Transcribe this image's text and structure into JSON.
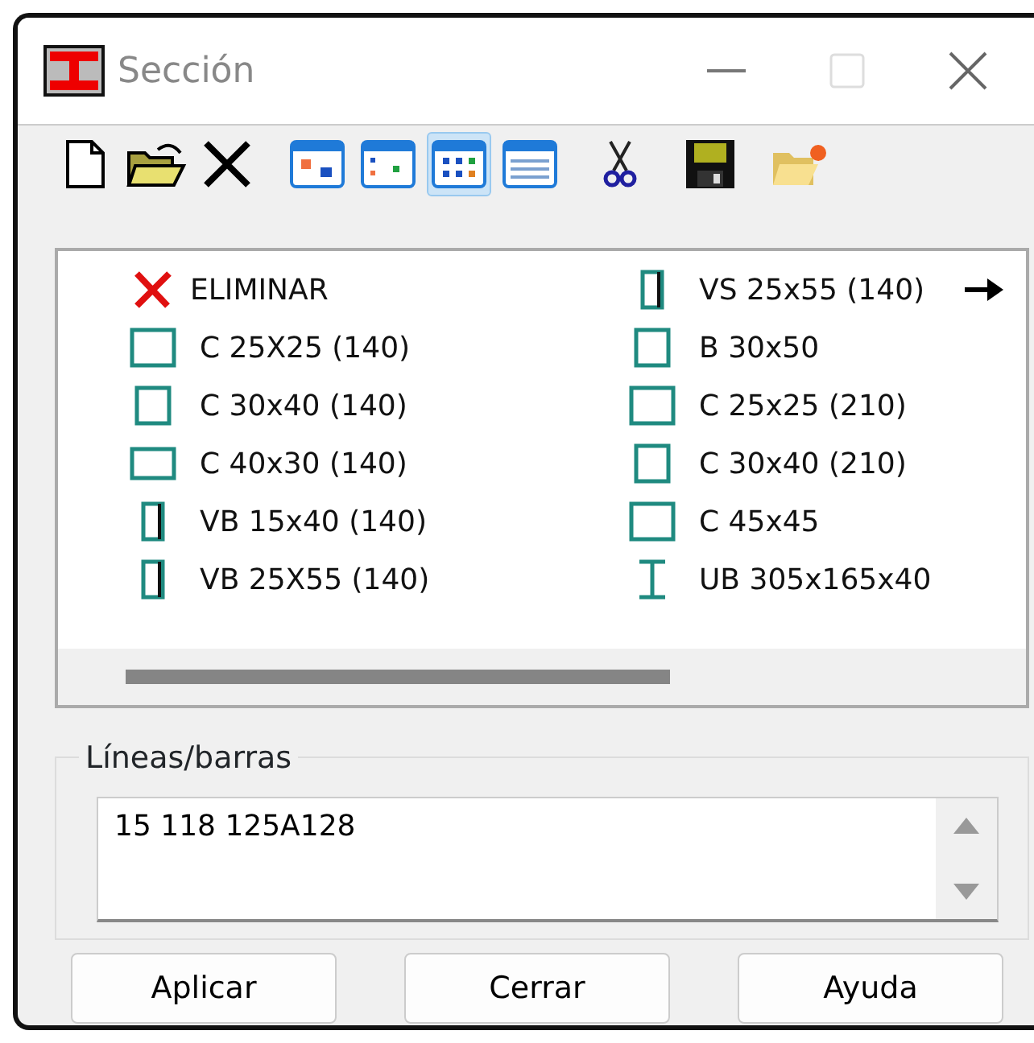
{
  "window": {
    "title": "Sección",
    "maximize_disabled": true
  },
  "toolbar": [
    {
      "kind": "new",
      "selected": false
    },
    {
      "kind": "open",
      "selected": false
    },
    {
      "kind": "delete",
      "selected": false
    },
    {
      "kind": "view-large",
      "selected": false
    },
    {
      "kind": "view-small",
      "selected": false
    },
    {
      "kind": "view-list",
      "selected": true
    },
    {
      "kind": "view-details",
      "selected": false
    },
    {
      "kind": "cut",
      "selected": false
    },
    {
      "kind": "save",
      "selected": false
    },
    {
      "kind": "new-folder",
      "selected": false
    }
  ],
  "sections": [
    {
      "label": "ELIMINAR",
      "kind": "delete",
      "marked": false
    },
    {
      "label": "C 25X25 (140)",
      "kind": "square-large",
      "marked": false
    },
    {
      "label": "C 30x40 (140)",
      "kind": "square",
      "marked": false
    },
    {
      "label": "C 40x30 (140)",
      "kind": "rect-wide",
      "marked": false
    },
    {
      "label": "VB 15x40 (140)",
      "kind": "rect-narrow",
      "marked": false
    },
    {
      "label": "VB 25X55 (140)",
      "kind": "rect-narrow",
      "marked": false
    },
    {
      "label": "VS 25x55 (140)",
      "kind": "rect-narrow",
      "marked": true
    },
    {
      "label": "B 30x50",
      "kind": "square",
      "marked": false
    },
    {
      "label": "C 25x25 (210)",
      "kind": "square-large",
      "marked": false
    },
    {
      "label": "C 30x40 (210)",
      "kind": "square",
      "marked": false
    },
    {
      "label": "C 45x45",
      "kind": "square-large",
      "marked": false
    },
    {
      "label": "UB 305x165x40",
      "kind": "i-beam",
      "marked": false
    }
  ],
  "lines_group": {
    "label": "Líneas/barras",
    "value": "15 118 125A128"
  },
  "buttons": [
    "Aplicar",
    "Cerrar",
    "Ayuda"
  ]
}
